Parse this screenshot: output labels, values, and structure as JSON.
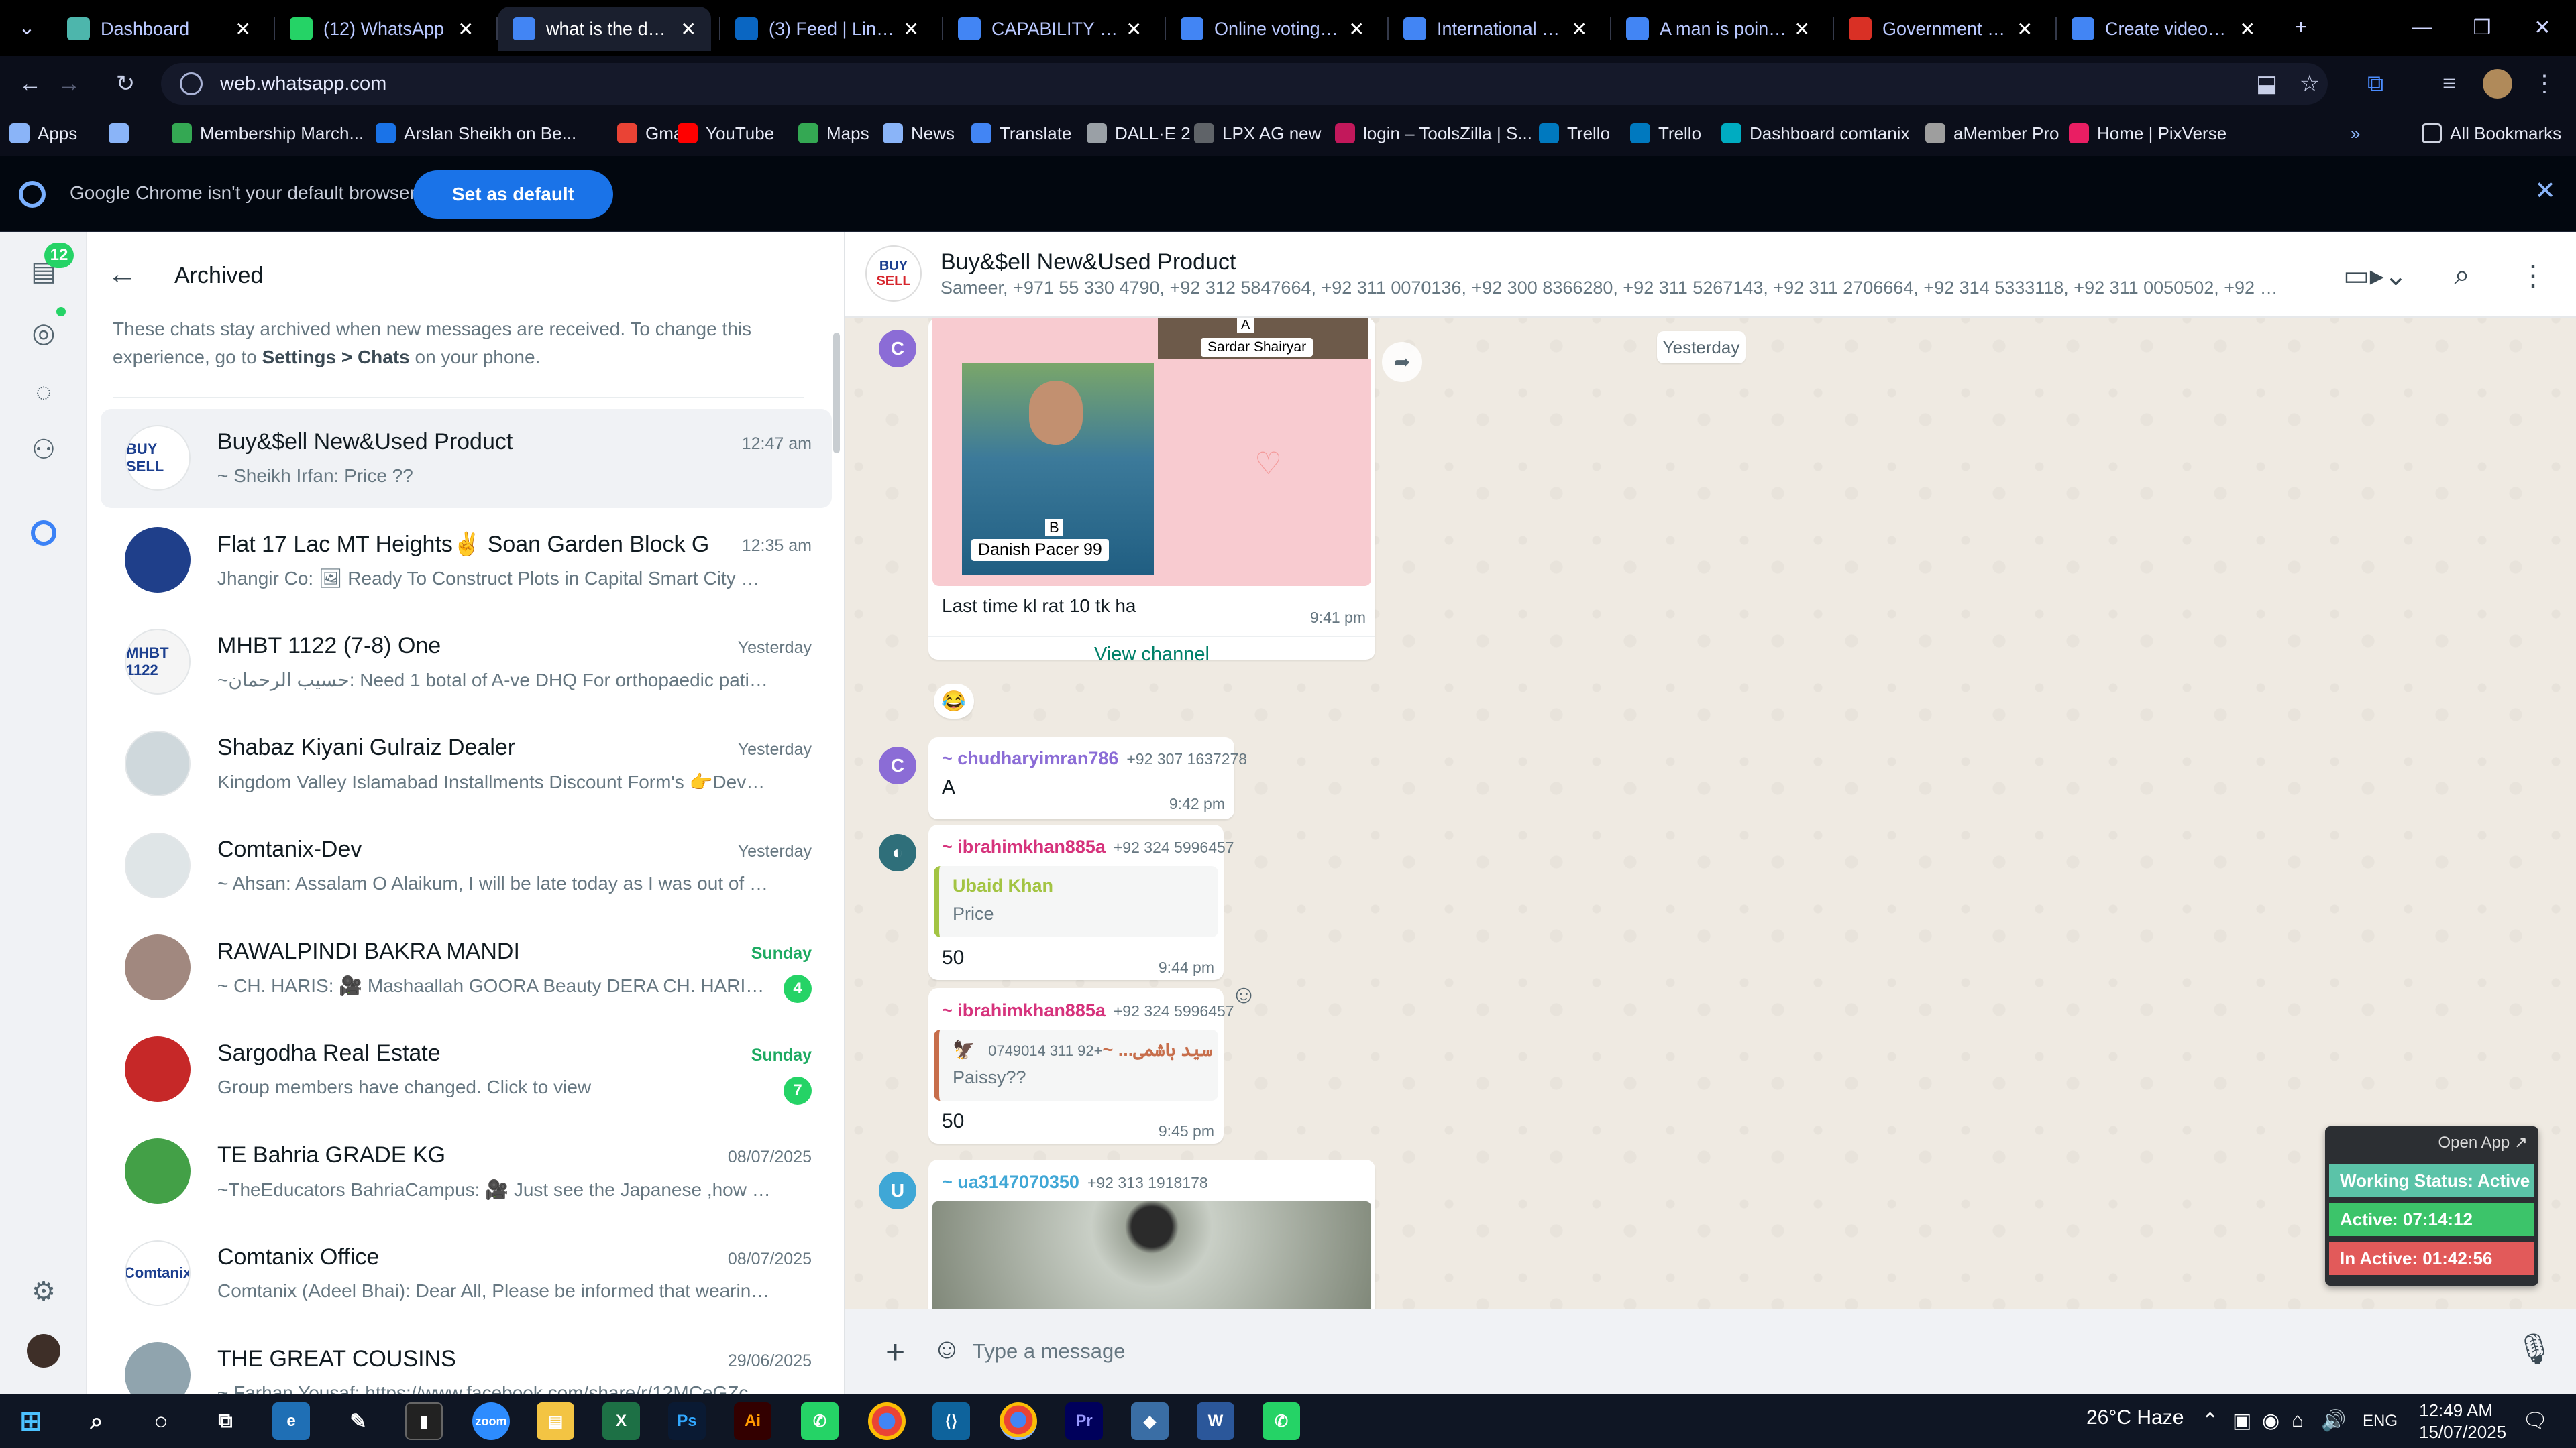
{
  "browser": {
    "tabs": [
      {
        "title": "Dashboard",
        "icon_color": "#4db6ac"
      },
      {
        "title": "(12) WhatsApp",
        "icon_color": "#25d366"
      },
      {
        "title": "what is the date o",
        "icon_color": "#4285f4"
      },
      {
        "title": "(3) Feed | LinkedIn",
        "icon_color": "#0a66c2"
      },
      {
        "title": "CAPABILITY STATE",
        "icon_color": "#4285f4"
      },
      {
        "title": "Online voting with",
        "icon_color": "#4285f4"
      },
      {
        "title": "International busi",
        "icon_color": "#4285f4"
      },
      {
        "title": "A man is pointing",
        "icon_color": "#4285f4"
      },
      {
        "title": "Government Cont",
        "icon_color": "#d93025"
      },
      {
        "title": "Create videos | Fr",
        "icon_color": "#4285f4"
      }
    ],
    "active_tab_index": 2,
    "url": "web.whatsapp.com",
    "bookmarks": [
      {
        "label": "Apps",
        "color": "#8ab4f8"
      },
      {
        "label": "",
        "color": "#8ab4f8"
      },
      {
        "label": "Membership March...",
        "color": "#34a853"
      },
      {
        "label": "Arslan Sheikh on Be...",
        "color": "#1a73e8"
      },
      {
        "label": "Gmail",
        "color": "#ea4335"
      },
      {
        "label": "YouTube",
        "color": "#ff0000"
      },
      {
        "label": "Maps",
        "color": "#34a853"
      },
      {
        "label": "News",
        "color": "#8ab4f8"
      },
      {
        "label": "Translate",
        "color": "#4285f4"
      },
      {
        "label": "DALL·E 2",
        "color": "#9aa0a6"
      },
      {
        "label": "LPX AG new",
        "color": "#5f6368"
      },
      {
        "label": "login – ToolsZilla | S...",
        "color": "#c2185b"
      },
      {
        "label": "Trello",
        "color": "#0079bf"
      },
      {
        "label": "Trello",
        "color": "#0079bf"
      },
      {
        "label": "Dashboard comtanix",
        "color": "#00acc1"
      },
      {
        "label": "aMember Pro",
        "color": "#9e9e9e"
      },
      {
        "label": "Home | PixVerse",
        "color": "#e91e63"
      }
    ],
    "all_bookmarks": "All Bookmarks",
    "default_bar": {
      "message": "Google Chrome isn't your default browser",
      "button": "Set as default"
    }
  },
  "whatsapp": {
    "rail_badge": "12",
    "archived": {
      "title": "Archived",
      "info_pre": "These chats stay archived when new messages are received. To change this experience, go to ",
      "info_path": "Settings > Chats",
      "info_post": " on your phone."
    },
    "chats": [
      {
        "name": "Buy&$ell New&Used Product",
        "time": "12:47 am",
        "preview": "~ Sheikh Irfan: Price ??",
        "unread": "",
        "avatar_text": "BUY SELL",
        "avatar_color": "#ffffff"
      },
      {
        "name": "Flat 17 Lac MT Heights✌️  Soan Garden Block G",
        "time": "12:35 am",
        "preview": "Jhangir Co: 🖼 Ready To Construct Plots in Capital Smart City  On Ins...",
        "unread": "",
        "avatar_text": "",
        "avatar_color": "#1f3f8a"
      },
      {
        "name": "MHBT 1122 (7-8) One",
        "time": "Yesterday",
        "preview": "~حسیب الرحمان: Need 1 botal of A-ve DHQ For orthopaedic patient ...",
        "unread": "",
        "avatar_text": "MHBT 1122",
        "avatar_color": "#f5f5f5"
      },
      {
        "name": "Shabaz Kiyani Gulraiz Dealer",
        "time": "Yesterday",
        "preview": "Kingdom Valley Islamabad Installments Discount Form's 👉Develop...",
        "unread": "",
        "avatar_text": "",
        "avatar_color": "#cfd8dc"
      },
      {
        "name": "Comtanix-Dev",
        "time": "Yesterday",
        "preview": "~ Ahsan: Assalam O Alaikum, I will be late today as I was out of city, j...",
        "unread": "",
        "avatar_text": "",
        "avatar_color": "#dfe5e7"
      },
      {
        "name": "RAWALPINDI BAKRA MANDI",
        "time": "Sunday",
        "preview": "~ CH. HARIS: 🎥 Mashaallah GOORA  Beauty DERA CH. HARIS. D...",
        "unread": "4",
        "avatar_text": "",
        "avatar_color": "#a1887f"
      },
      {
        "name": "Sargodha Real Estate",
        "time": "Sunday",
        "preview": "Group members have changed. Click to view",
        "unread": "7",
        "avatar_text": "",
        "avatar_color": "#c62828"
      },
      {
        "name": "TE Bahria GRADE KG",
        "time": "08/07/2025",
        "preview": "~TheEducators BahriaCampus: 🎥 Just see  the Japanese ,how they ...",
        "unread": "",
        "avatar_text": "",
        "avatar_color": "#43a047"
      },
      {
        "name": "Comtanix Office",
        "time": "08/07/2025",
        "preview": "Comtanix (Adeel Bhai): Dear All,  Please be informed that wearing yo...",
        "unread": "",
        "avatar_text": "Comtanix",
        "avatar_color": "#ffffff"
      },
      {
        "name": "THE GREAT COUSINS",
        "time": "29/06/2025",
        "preview": "~ Farhan Yousaf: https://www.facebook.com/share/r/12MCeGZcXhH/",
        "unread": "",
        "avatar_text": "",
        "avatar_color": "#90a4ae"
      }
    ],
    "conversation": {
      "title": "Buy&$ell New&Used Product",
      "members": "Sameer, +971 55 330 4790, +92 312 5847664, +92 311 0070136, +92 300 8366280, +92 311 5267143, +92 311 2706664, +92 314 5333118, +92 311 0050502, +92 333 98714...",
      "date_divider": "Yesterday",
      "channel_card": {
        "label_a": "A",
        "name_a": "Sardar Shairyar",
        "label_b": "B",
        "name_b": "Danish Pacer 99",
        "caption": "Last time kl rat 10 tk ha",
        "time": "9:41 pm",
        "view_channel": "View channel",
        "reaction": "😂"
      },
      "messages": [
        {
          "avatar": "C",
          "sender": "~ chudharyimran786",
          "phone": "+92 307 1637278",
          "text": "A",
          "time": "9:42 pm"
        },
        {
          "sender": "~ ibrahimkhan885a",
          "phone": "+92 324 5996457",
          "quote_name": "Ubaid Khan",
          "quote_text": "Price",
          "text": "50",
          "time": "9:44 pm"
        },
        {
          "sender": "~ ibrahimkhan885a",
          "phone": "+92 324 5996457",
          "quote_name": "🦅 سید ہاشمی... ~",
          "quote_phone": "+92 311 0749014",
          "quote_text": "Paissy??",
          "text": "50",
          "time": "9:45 pm"
        },
        {
          "avatar": "U",
          "sender": "~ ua3147070350",
          "phone": "+92 313 1918178"
        }
      ],
      "input_placeholder": "Type a message"
    }
  },
  "status_widget": {
    "open_app": "Open App ↗",
    "working_status": "Working Status: Active",
    "active": "Active: 07:14:12",
    "inactive": "In Active: 01:42:56"
  },
  "taskbar": {
    "weather": "26°C  Haze",
    "lang": "ENG",
    "time": "12:49 AM",
    "date": "15/07/2025"
  }
}
